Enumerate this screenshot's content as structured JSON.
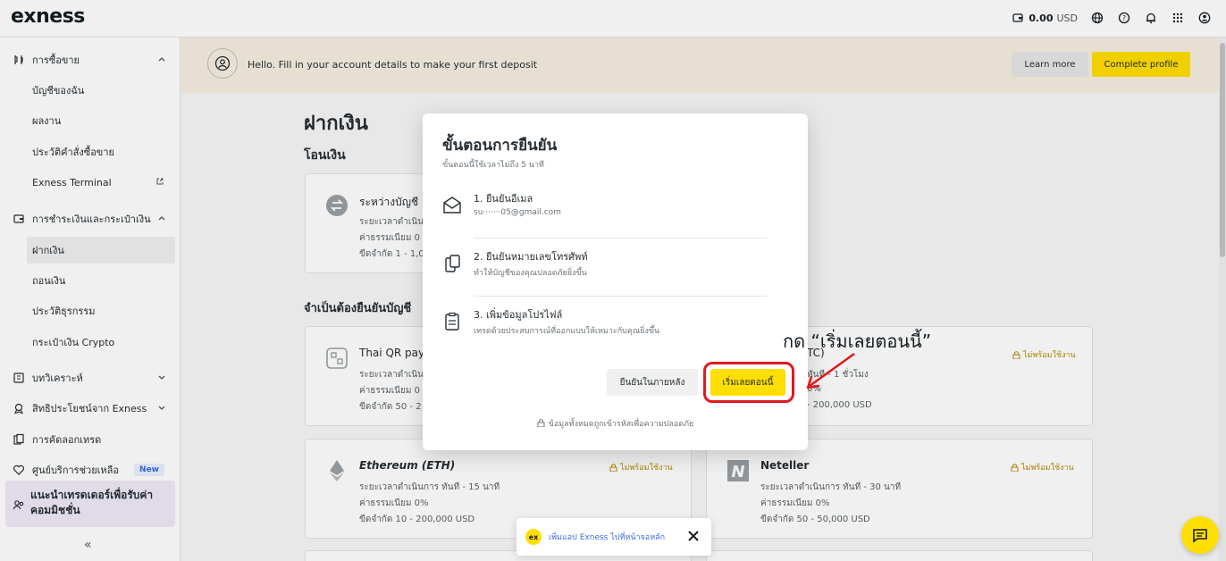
{
  "app": {
    "logo": "exness"
  },
  "topbar": {
    "balance_amount": "0.00",
    "balance_currency": "USD"
  },
  "sidebar": {
    "sections": [
      {
        "label": "การซื้อขาย",
        "items": [
          "บัญชีของฉัน",
          "ผลงาน",
          "ประวัติคำสั่งซื้อขาย",
          "Exness Terminal"
        ]
      },
      {
        "label": "การชำระเงินและกระเป๋าเงิน",
        "items": [
          "ฝากเงิน",
          "ถอนเงิน",
          "ประวัติธุรกรรม",
          "กระเป๋าเงิน Crypto"
        ]
      },
      {
        "label": "บทวิเคราะห์"
      },
      {
        "label": "สิทธิประโยชน์จาก Exness"
      },
      {
        "label": "การคัดลอกเทรด"
      },
      {
        "label": "ศูนย์บริการช่วยเหลือ",
        "badge": "New"
      }
    ],
    "referral_line1": "แนะนำเทรดเดอร์เพื่อรับค่า",
    "referral_line2": "คอมมิชชั่น",
    "collapse": "«"
  },
  "banner": {
    "text": "Hello. Fill in your account details to make your first deposit",
    "learn_more": "Learn more",
    "complete_profile": "Complete profile"
  },
  "main": {
    "title": "ฝากเงิน",
    "section_transfer": "โอนเงิน",
    "section_verify": "จำเป็นต้องยืนยันบัญชี",
    "card_transfer": {
      "title": "ระหว่างบัญชี",
      "l1": "ระยะเวลาดำเนิน",
      "l2": "ค่าธรรมเนียม 0",
      "l3": "ขีดจำกัด 1 - 1,0"
    },
    "card_thaiqr": {
      "title": "Thai QR paym",
      "l1": "ระยะเวลาดำเนิน",
      "l2": "ค่าธรรมเนียม 0",
      "l3": "ขีดจำกัด 50 - 2"
    },
    "card_btc": {
      "title": "TC)",
      "l1": "ทันที - 1 ชั่วโมง",
      "l2": "0%",
      "l3": "- 200,000 USD",
      "badge": "ไม่พร้อมใช้งาน"
    },
    "card_eth": {
      "title": "Ethereum (ETH)",
      "l1": "ระยะเวลาดำเนินการ ทันที - 15 นาที",
      "l2": "ค่าธรรมเนียม 0%",
      "l3": "ขีดจำกัด 10 - 200,000 USD",
      "badge": "ไม่พร้อมใช้งาน"
    },
    "card_neteller": {
      "title": "Neteller",
      "l1": "ระยะเวลาดำเนินการ ทันที - 30 นาที",
      "l2": "ค่าธรรมเนียม 0%",
      "l3": "ขีดจำกัด 50 - 50,000 USD",
      "badge": "ไม่พร้อมใช้งาน"
    }
  },
  "modal": {
    "title": "ขั้นตอนการยืนยัน",
    "subtitle": "ขั้นตอนนี้ใช้เวลาไม่ถึง 5 นาที",
    "steps": [
      {
        "title": "1. ยืนยันอีเมล",
        "sub": "su·······05@gmail.com"
      },
      {
        "title": "2. ยืนยันหมายเลขโทรศัพท์",
        "sub": "ทำให้บัญชีของคุณปลอดภัยยิ่งขึ้น"
      },
      {
        "title": "3. เพิ่มข้อมูลโปรไฟล์",
        "sub": "เทรดด้วยประสบการณ์ที่ออกแบบให้เหมาะกับคุณยิ่งขึ้น"
      }
    ],
    "later": "ยืนยันในภายหลัง",
    "start": "เริ่มเลยตอนนี้",
    "footer": "ข้อมูลทั้งหมดถูกเข้ารหัสเพื่อความปลอดภัย"
  },
  "annotation": {
    "text": "กด “เริ่มเลยตอนนี้”",
    "color": "#e0191f"
  },
  "toast": {
    "logo": "ex",
    "text": "เพิ่มแอป Exness ไปที่หน้าจอหลัก"
  },
  "colors": {
    "brand_yellow": "#ffde02",
    "banner_bg": "#f6efe0",
    "unavailable": "#b68a00"
  }
}
